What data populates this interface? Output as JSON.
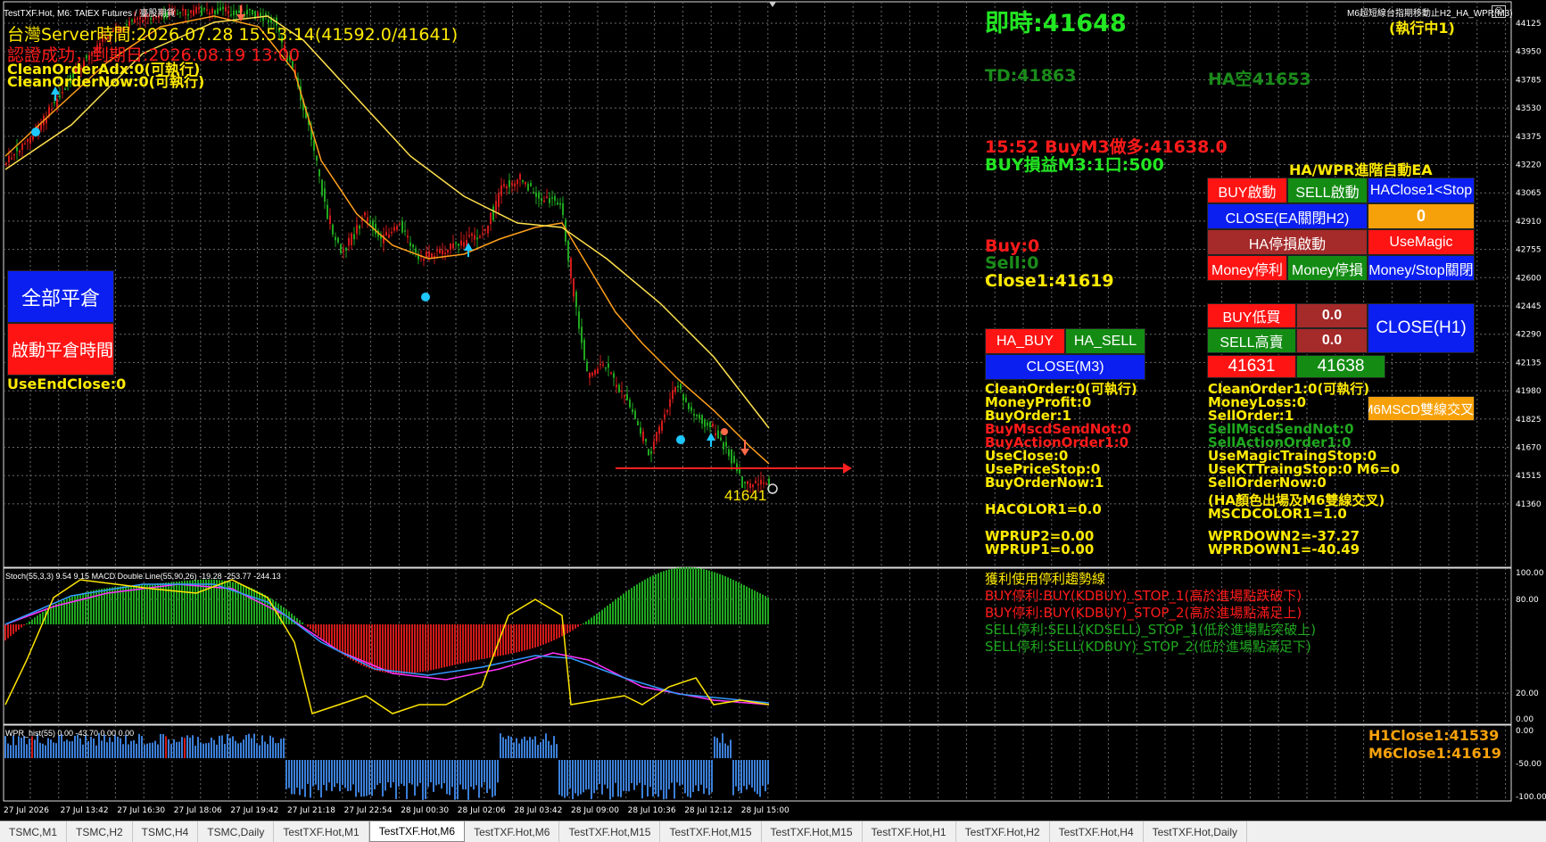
{
  "window": {
    "chart_title": "TestTXF.Hot, M6:  TAIEX Futures / 臺股期貨",
    "ea_title": "M6超短線台指期移動止H2_HA_WPR(M3)",
    "ea_status": "(執行中1)"
  },
  "header": {
    "server_time": "台灣Server時間:2026.07.28 15:53:14(41592.0/41641)",
    "auth": "認證成功，到期日:2026.08.19 13:00",
    "clean_order_adx": "CleanOrderAdx:0(可執行)",
    "clean_order_now": "CleanOrderNow:0(可執行)"
  },
  "left_panel": {
    "close_all_label": "全部平倉",
    "close_time_label": "啟動平倉時間",
    "use_end_close": "UseEndClose:0"
  },
  "info": {
    "realtime": "即時:41648",
    "td": "TD:41863",
    "ha_empty": "HA空41653",
    "buy_signal": "15:52 BuyM3做多:41638.0",
    "buy_pnl": "BUY損益M3:1口:500",
    "buy_count": "Buy:0",
    "sell_count": "Sell:0",
    "close1": "Close1:41619"
  },
  "ea_panel": {
    "title": "HA/WPR進階自動EA",
    "buttons": {
      "buy_start": "BUY啟動",
      "sell_start": "SELL啟動",
      "haclose_stop": "HAClose1<Stop",
      "close_ea": "CLOSE(EA關閉H2)",
      "zero": "0",
      "ha_stop": "HA停損啟動",
      "use_magic": "UseMagic",
      "money_profit": "Money停利",
      "money_loss": "Money停損",
      "money_stop_close": "Money/Stop關閉",
      "ha_buy": "HA_BUY",
      "ha_sell": "HA_SELL",
      "close_m3": "CLOSE(M3)",
      "buy_low": "BUY低買",
      "buy_low_val": "0.0",
      "sell_high": "SELL高賣",
      "sell_high_val": "0.0",
      "close_h1": "CLOSE(H1)",
      "price_a": "41631",
      "price_b": "41638",
      "mscd_cross": "M6MSCD雙線交叉"
    }
  },
  "status_left": [
    "CleanOrder:0(可執行)",
    "MoneyProfit:0",
    "BuyOrder:1",
    "BuyMscdSendNot:0",
    "BuyActionOrder1:0",
    "UseClose:0",
    "UsePriceStop:0",
    "BuyOrderNow:1",
    "HACOLOR1=0.0",
    "WPRUP2=0.00",
    "WPRUP1=0.00"
  ],
  "status_right": [
    "CleanOrder1:0(可執行)",
    "MoneyLoss:0",
    "SellOrder:1",
    "SellMscdSendNot:0",
    "SellActionOrder1:0",
    "UseMagicTraingStop:0",
    "UseKTTraingStop:0  M6=0",
    "SellOrderNow:0",
    "(HA顏色出場及M6雙線交叉)",
    "MSCDCOLOR1=1.0",
    "WPRDOWN2=-37.27",
    "WPRDOWN1=-40.49"
  ],
  "stop_rules": [
    "獲利使用停利趨勢線",
    "BUY停利:BUY(KDBUY)_STOP_1(高於進場點跌破下)",
    "BUY停利:BUY(KDBUY)_STOP_2(高於進場點滿足上)",
    "SELL停利:SELL(KDSELL)_STOP_1(低於進場點突破上)",
    "SELL停利:SELL(KDBUY)_STOP_2(低於進場點滿足下)"
  ],
  "bottom_right": {
    "h1_close": "H1Close1:41539",
    "m6_close": "M6Close1:41619"
  },
  "price_marker": "41641",
  "indicators": {
    "stoch_macd_header": "Stoch(55,3,3) 9.54 9.15 MACD Double Line(55,90,26) -19.28 -253.77 -244.13",
    "wpr_header": "WPR_hist(55) 0.00 -43.70 0.00 0.00"
  },
  "price_axis": [
    "44125",
    "43950",
    "43785",
    "43530",
    "43375",
    "43220",
    "43065",
    "42910",
    "42755",
    "42600",
    "42445",
    "42290",
    "42135",
    "41980",
    "41825",
    "41670",
    "41515",
    "41360"
  ],
  "stoch_axis": [
    "100.00",
    "80.00",
    "20.00",
    "0.00"
  ],
  "wpr_axis": [
    "0.00",
    "-50.00",
    "-100.00"
  ],
  "time_axis": [
    "27 Jul 2026",
    "27 Jul 13:42",
    "27 Jul 16:30",
    "27 Jul 18:06",
    "27 Jul 19:42",
    "27 Jul 21:18",
    "27 Jul 22:54",
    "28 Jul 00:30",
    "28 Jul 02:06",
    "28 Jul 03:42",
    "28 Jul 09:00",
    "28 Jul 10:36",
    "28 Jul 12:12",
    "28 Jul 15:00"
  ],
  "tabs": [
    "TSMC,M1",
    "TSMC,H2",
    "TSMC,H4",
    "TSMC,Daily",
    "TestTXF.Hot,M1",
    "TestTXF.Hot,M6",
    "TestTXF.Hot,M6",
    "TestTXF.Hot,M15",
    "TestTXF.Hot,M15",
    "TestTXF.Hot,M15",
    "TestTXF.Hot,H1",
    "TestTXF.Hot,H2",
    "TestTXF.Hot,H4",
    "TestTXF.Hot,Daily"
  ],
  "active_tab_index": 5,
  "colors": {
    "yellow": "#ffea00",
    "green_text": "#1db41d",
    "red_text": "#ff1a1a",
    "bull": "#1fa81f",
    "bear": "#d11a1a",
    "grid": "#6b6b6b"
  }
}
